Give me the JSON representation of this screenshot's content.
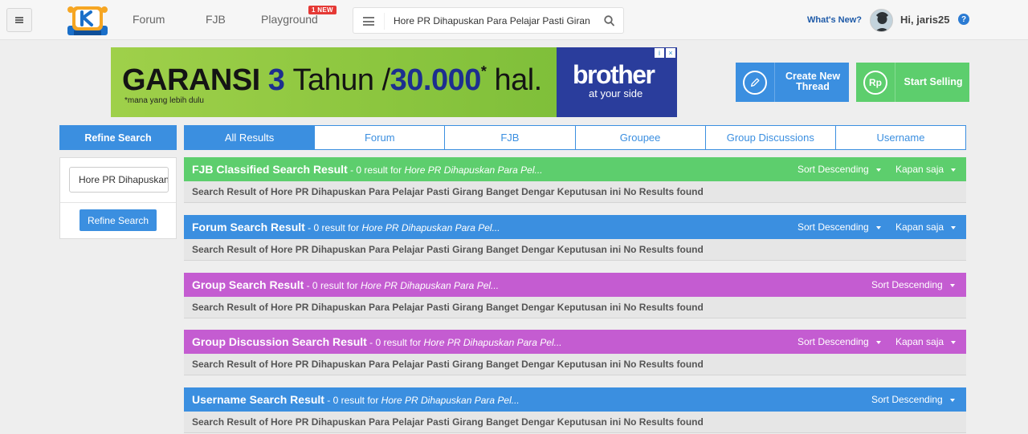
{
  "header": {
    "nav": {
      "forum": "Forum",
      "fjb": "FJB",
      "playground": "Playground",
      "new_badge": "1 NEW"
    },
    "search": {
      "value": "Hore PR Dihapuskan Para Pelajar Pasti Girang"
    },
    "whats_new": "What's New?",
    "greeting": "Hi, jaris25",
    "help": "?"
  },
  "ad": {
    "garansi": "GARANSI",
    "three": "3",
    "tahun": "Tahun /",
    "amount": "30.000",
    "star": "*",
    "hal": "hal.",
    "note": "*mana yang lebih dulu",
    "brand": "brother",
    "tagline": "at your side",
    "choices_i": "i",
    "choices_x": "×"
  },
  "actions": {
    "create_line1": "Create New",
    "create_line2": "Thread",
    "sell": "Start Selling",
    "sell_icon": "Rp"
  },
  "refine": {
    "title": "Refine Search",
    "input_value": "Hore PR Dihapuskan",
    "button": "Refine Search"
  },
  "tabs": [
    "All Results",
    "Forum",
    "FJB",
    "Groupee",
    "Group Discussions",
    "Username"
  ],
  "sections": [
    {
      "title": "FJB Classified Search Result",
      "count": " - 0 result for ",
      "query": "Hore PR Dihapuskan Para Pel...",
      "sort": "Sort Descending",
      "time": "Kapan saja",
      "color": "#5dce6d",
      "body": "Search Result of Hore PR Dihapuskan Para Pelajar Pasti Girang Banget Dengar Keputusan ini No Results found"
    },
    {
      "title": "Forum Search Result",
      "count": " - 0 result for ",
      "query": "Hore PR Dihapuskan Para Pel...",
      "sort": "Sort Descending",
      "time": "Kapan saja",
      "color": "#3b8fe0",
      "body": "Search Result of Hore PR Dihapuskan Para Pelajar Pasti Girang Banget Dengar Keputusan ini No Results found"
    },
    {
      "title": "Group Search Result",
      "count": " - 0 result for ",
      "query": "Hore PR Dihapuskan Para Pel...",
      "sort": "Sort Descending",
      "color": "#c45cd1",
      "body": "Search Result of Hore PR Dihapuskan Para Pelajar Pasti Girang Banget Dengar Keputusan ini No Results found"
    },
    {
      "title": "Group Discussion Search Result",
      "count": " - 0 result for ",
      "query": "Hore PR Dihapuskan Para Pel...",
      "sort": "Sort Descending",
      "time": "Kapan saja",
      "color": "#c45cd1",
      "body": "Search Result of Hore PR Dihapuskan Para Pelajar Pasti Girang Banget Dengar Keputusan ini No Results found"
    },
    {
      "title": "Username Search Result",
      "count": " - 0 result for ",
      "query": "Hore PR Dihapuskan Para Pel...",
      "sort": "Sort Descending",
      "color": "#3b8fe0",
      "body": "Search Result of Hore PR Dihapuskan Para Pelajar Pasti Girang Banget Dengar Keputusan ini No Results found"
    }
  ]
}
